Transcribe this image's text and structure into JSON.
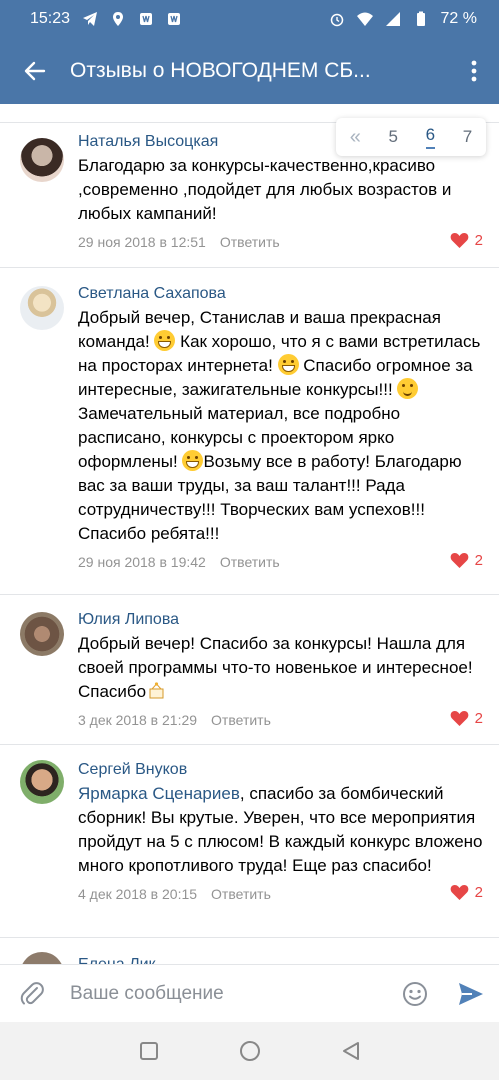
{
  "status_bar": {
    "time": "15:23",
    "battery": "72 %"
  },
  "toolbar": {
    "title": "Отзывы о НОВОГОДНЕМ СБ..."
  },
  "pager": {
    "pages": [
      "5",
      "6",
      "7"
    ],
    "active": "6"
  },
  "comments": [
    {
      "author": "Наталья Высоцкая",
      "text": "Благодарю за конкурсы-качественно,красиво ,современно ,подойдет для любых возрастов и любых кампаний!",
      "date": "29 ноя 2018 в 12:51",
      "reply": "Ответить",
      "likes": "2"
    },
    {
      "author": "Светлана Сахапова",
      "text_parts": [
        "Добрый вечер, Станислав и ваша прекрасная команда! ",
        " Как хорошо, что я с вами встретилась на просторах интернета! ",
        " Спасибо огромное за интересные, зажигательные конкурсы!!! ",
        "Замечательный материал, все подробно расписано, конкурсы с проектором ярко оформлены! ",
        "Возьму все в работу! Благодарю вас за ваши труды, за ваш талант!!! Рада сотрудничеству!!! Творческих вам успехов!!! Спасибо ребята!!!"
      ],
      "date": "29 ноя 2018 в 19:42",
      "reply": "Ответить",
      "likes": "2"
    },
    {
      "author": "Юлия Липова",
      "text": "Добрый вечер! Спасибо за конкурсы! Нашла для своей программы что-то новенькое и интересное! Спасибо",
      "date": "3 дек 2018 в 21:29",
      "reply": "Ответить",
      "likes": "2"
    },
    {
      "author": "Сергей Внуков",
      "mention": "Ярмарка Сценариев",
      "text": ", спасибо за бомбический сборник! Вы крутые. Уверен, что все мероприятия пройдут на 5 с плюсом! В каждый конкурс вложено много кропотливого труда! Еще раз спасибо!",
      "date": "4 дек 2018 в 20:15",
      "reply": "Ответить",
      "likes": "2"
    }
  ],
  "peek_author": "Елена Лик",
  "input": {
    "placeholder": "Ваше сообщение"
  },
  "colors": {
    "brand": "#4a76a8",
    "link": "#2a5885",
    "like": "#e64646",
    "meta": "#939393"
  }
}
